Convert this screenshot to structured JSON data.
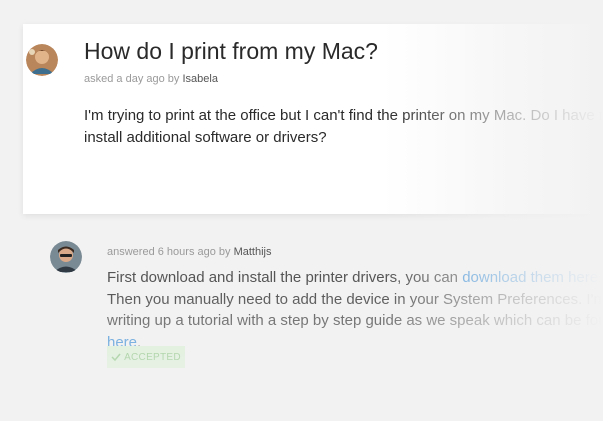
{
  "question": {
    "title": "How do I print from my Mac?",
    "meta_prefix": "asked a day ago by",
    "author": "Isabela",
    "body": "I'm trying to print at the office but I can't find the printer on my Mac. Do I have to install additional software or drivers?"
  },
  "answer": {
    "meta_prefix": "answered 6 hours ago by",
    "author": "Matthijs",
    "body_part1": "First download and install the printer drivers, you can ",
    "link1": "download them here",
    "body_part2": ". Then you manually need to add the device in your System Preferences. I'm writing up a tutorial with a step by step guide as we speak which can be found ",
    "link2": "here",
    "body_part3": ".",
    "accepted_label": "ACCEPTED"
  },
  "colors": {
    "background": "#f2f2f2",
    "card": "#ffffff",
    "link": "#3a8ed6",
    "accepted_bg": "#d9f0d4",
    "accepted_text": "#7fbf74"
  }
}
